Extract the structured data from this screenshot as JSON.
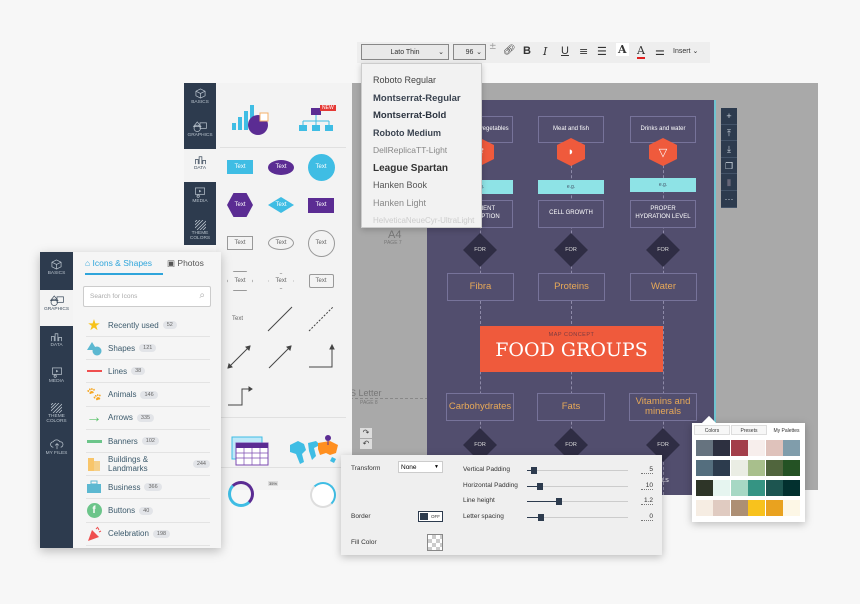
{
  "toolbar": {
    "font": "Lato Thin",
    "size": "96",
    "insert": "Insert"
  },
  "font_menu": [
    "Roboto Regular",
    "Montserrat-Regular",
    "Montserrat-Bold",
    "Roboto Medium",
    "DellReplicaTT-Light",
    "League Spartan",
    "Hanken Book",
    "Hanken Light",
    "HelveticaNeueCyr-UltraLight"
  ],
  "pages": {
    "p7_size": "A4",
    "p7_label": "PAGE 7",
    "p8_size": "S Letter",
    "p8_label": "PAGE 8"
  },
  "poster": {
    "top": [
      "Fruits and vegetables",
      "Meat and fish",
      "Drinks and water"
    ],
    "eg": [
      "e.g.",
      "e.g.",
      "e.g."
    ],
    "mid": [
      "NUTRIENT ABSORPTION",
      "CELL GROWTH",
      "PROPER HYDRATION LEVEL"
    ],
    "for": "FOR",
    "row1": [
      "Fibra",
      "Proteins",
      "Water"
    ],
    "subtitle": "MAP CONCEPT",
    "title": "FOOD GROUPS",
    "row2": [
      "Carbohydrates",
      "Fats",
      "Vitamins and minerals"
    ],
    "bottom_right": "HEALTHY CELLS",
    "colors": {
      "bg": "#524e6e",
      "accent": "#ef5a3c",
      "cyan": "#8ee3e6",
      "label": "#e8a958"
    }
  },
  "mid_sidebar": [
    "BASICS",
    "GRAPHICS",
    "DATA",
    "MEDIA",
    "THEME COLORS"
  ],
  "mid_panel": {
    "new_badge": "NEW",
    "text": "Text",
    "percent": "35%"
  },
  "front": {
    "sidebar": [
      "BASICS",
      "GRAPHICS",
      "DATA",
      "MEDIA",
      "THEME COLORS",
      "MY FILES"
    ],
    "tabs": [
      "Icons & Shapes",
      "Photos"
    ],
    "search_placeholder": "Search for Icons",
    "items": [
      {
        "label": "Recently used",
        "count": "52",
        "icon": "star-icon"
      },
      {
        "label": "Shapes",
        "count": "121",
        "icon": "shapes-icon"
      },
      {
        "label": "Lines",
        "count": "38",
        "icon": "line-icon"
      },
      {
        "label": "Animals",
        "count": "146",
        "icon": "paw-icon"
      },
      {
        "label": "Arrows",
        "count": "335",
        "icon": "arrow-icon"
      },
      {
        "label": "Banners",
        "count": "102",
        "icon": "banner-icon"
      },
      {
        "label": "Buildings & Landmarks",
        "count": "244",
        "icon": "building-icon"
      },
      {
        "label": "Business",
        "count": "366",
        "icon": "briefcase-icon"
      },
      {
        "label": "Buttons",
        "count": "40",
        "icon": "facebook-icon"
      },
      {
        "label": "Celebration",
        "count": "198",
        "icon": "party-icon"
      }
    ]
  },
  "props": {
    "transform_label": "Transform",
    "transform_value": "None",
    "border_label": "Border",
    "border_toggle": "OFF",
    "fill_label": "Fill Color",
    "sliders": [
      {
        "label": "Vertical Padding",
        "value": "5",
        "fraction": 0.07
      },
      {
        "label": "Horizontal Padding",
        "value": "10",
        "fraction": 0.13
      },
      {
        "label": "Line height",
        "value": "1.2",
        "fraction": 0.32
      },
      {
        "label": "Letter spacing",
        "value": "0",
        "fraction": 0.14
      }
    ]
  },
  "colors_panel": {
    "tabs": [
      "Colors",
      "Presets",
      "My Palettes"
    ],
    "swatches": [
      [
        "#66737f",
        "#2d3040",
        "#a33e4a",
        "#f7eeec",
        "#dfc2bb",
        "#809dab"
      ],
      [
        "#546e7e",
        "#2c3b4d",
        "#eaede4",
        "#a8bf8c",
        "#50653d",
        "#245224"
      ],
      [
        "#2e3528",
        "#e6f5f0",
        "#a7d8c4",
        "#359483",
        "#1d5550",
        "#02302f"
      ],
      [
        "#f6ede3",
        "#e0cbc1",
        "#ad8f74",
        "#f8c21d",
        "#e9a21f",
        "#fdf7e6"
      ]
    ]
  },
  "vertical_tools": [
    "add-icon",
    "move-up-icon",
    "move-down-icon",
    "duplicate-icon",
    "trash-icon",
    "more-icon"
  ]
}
